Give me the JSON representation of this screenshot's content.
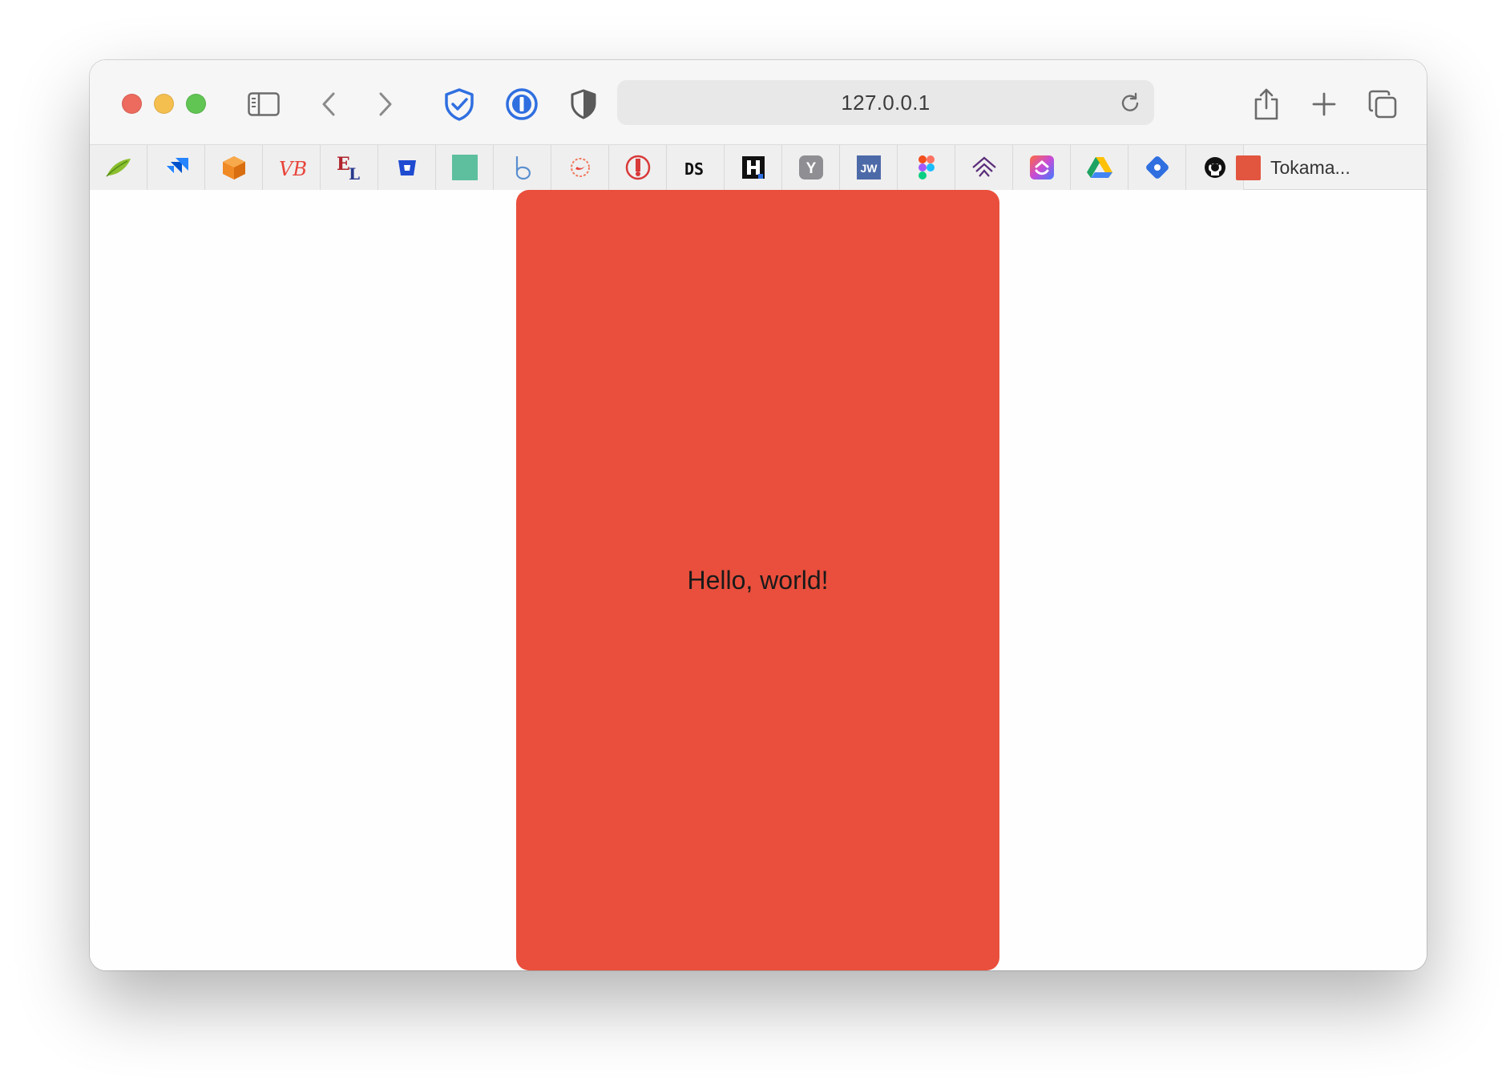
{
  "browser": {
    "address_url": "127.0.0.1",
    "bookmark_tab_label": "Tokama..."
  },
  "favorites": [
    {
      "icon": "leaf-icon"
    },
    {
      "icon": "jira-icon"
    },
    {
      "icon": "box-icon"
    },
    {
      "icon": "vb-icon",
      "text": "VB"
    },
    {
      "icon": "el-icon",
      "text": "EL"
    },
    {
      "icon": "bitbucket-icon"
    },
    {
      "icon": "green-square-icon"
    },
    {
      "icon": "b-icon"
    },
    {
      "icon": "swift-icon"
    },
    {
      "icon": "red-circle-icon"
    },
    {
      "icon": "ds-icon",
      "text": "DS"
    },
    {
      "icon": "h-icon",
      "text": "H"
    },
    {
      "icon": "y-icon",
      "text": "Y"
    },
    {
      "icon": "jw-icon",
      "text": "JW"
    },
    {
      "icon": "figma-icon"
    },
    {
      "icon": "layers-icon"
    },
    {
      "icon": "clickup-icon"
    },
    {
      "icon": "google-drive-icon"
    },
    {
      "icon": "blue-diamond-icon"
    },
    {
      "icon": "github-icon"
    }
  ],
  "page": {
    "card_text": "Hello, world!",
    "card_color": "#e94f3c"
  }
}
